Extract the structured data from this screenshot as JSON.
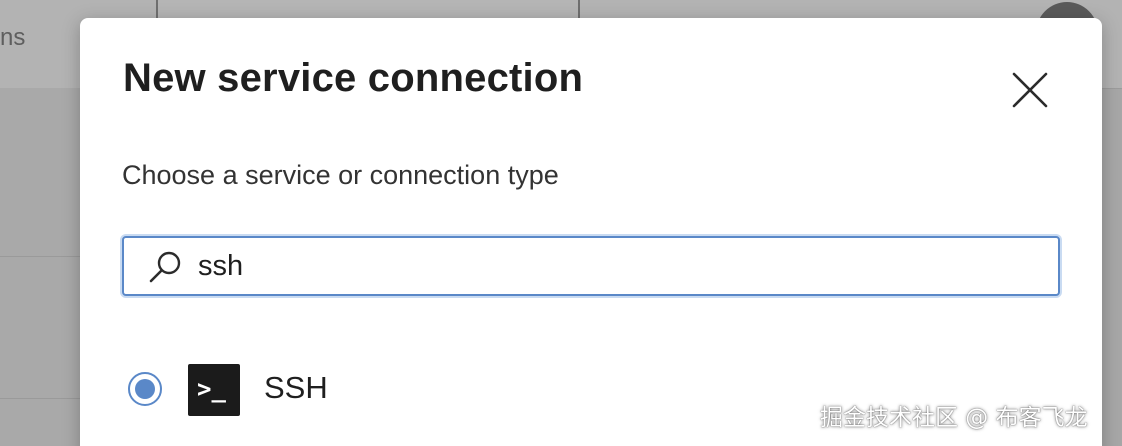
{
  "background": {
    "nav_text_fragment": "ns"
  },
  "dialog": {
    "title": "New service connection",
    "close_icon": "close-icon",
    "subtitle": "Choose a service or connection type",
    "search": {
      "icon": "search-icon",
      "value": "ssh",
      "placeholder": ""
    },
    "options": [
      {
        "label": "SSH",
        "icon": "terminal-icon",
        "icon_glyph": ">_",
        "selected": true
      }
    ]
  },
  "watermark": "掘金技术社区 @ 布客飞龙",
  "colors": {
    "accent": "#5a88c8",
    "title_text": "#1f1f1f",
    "overlay": "#a7a7a7"
  }
}
